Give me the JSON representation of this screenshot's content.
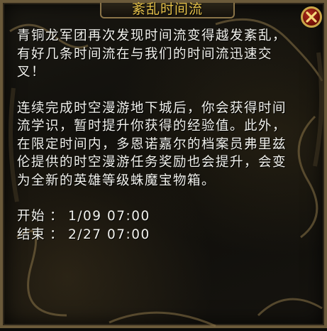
{
  "window": {
    "title": "紊乱时间流",
    "close_icon": "close-icon",
    "colors": {
      "title": "#e6c24a",
      "body_text": "#f1f1ec",
      "frame_gold": "#c9a648",
      "close_red": "#8b1a0e"
    }
  },
  "content": {
    "para1": "青铜龙军团再次发现时间流变得越发紊乱，有好几条时间流在与我们的时间流迅速交叉！",
    "para2": "连续完成时空漫游地下城后，你会获得时间流学识，暂时提升你获得的经验值。此外，在限定时间内，多恩诺嘉尔的档案员弗里兹伦提供的时空漫游任务奖励也会提升，会变为全新的英雄等级蛛魔宝物箱。",
    "start_label": "开始",
    "start_value": "1/09 07:00",
    "end_label": "结束",
    "end_value": "2/27 07:00",
    "separator": "："
  }
}
